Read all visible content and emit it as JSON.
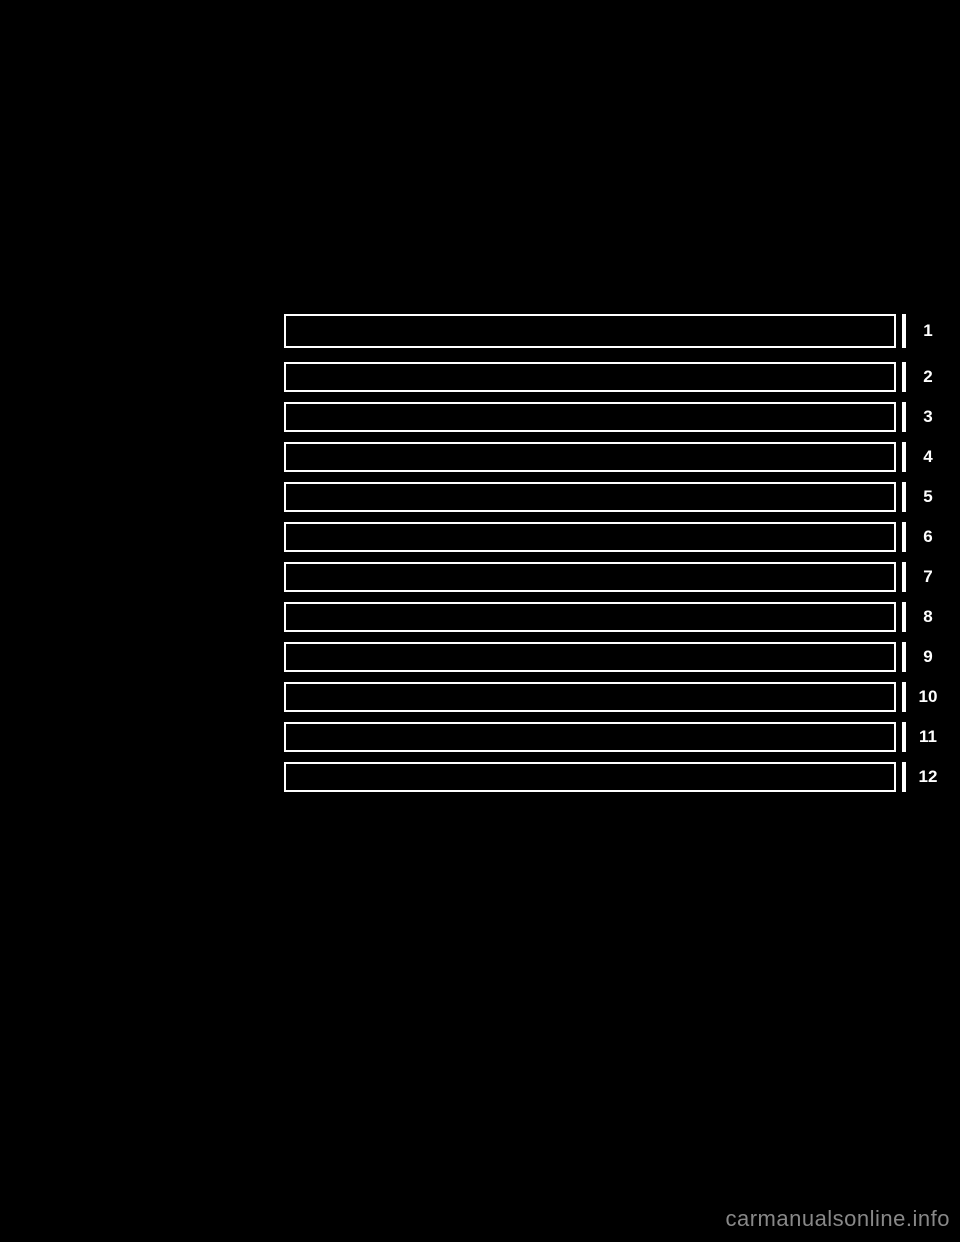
{
  "toc": {
    "rows": [
      {
        "label": "",
        "number": "1"
      },
      {
        "label": "",
        "number": "2"
      },
      {
        "label": "",
        "number": "3"
      },
      {
        "label": "",
        "number": "4"
      },
      {
        "label": "",
        "number": "5"
      },
      {
        "label": "",
        "number": "6"
      },
      {
        "label": "",
        "number": "7"
      },
      {
        "label": "",
        "number": "8"
      },
      {
        "label": "",
        "number": "9"
      },
      {
        "label": "",
        "number": "10"
      },
      {
        "label": "",
        "number": "11"
      },
      {
        "label": "",
        "number": "12"
      }
    ]
  },
  "footer": {
    "watermark": "carmanualsonline.info"
  }
}
